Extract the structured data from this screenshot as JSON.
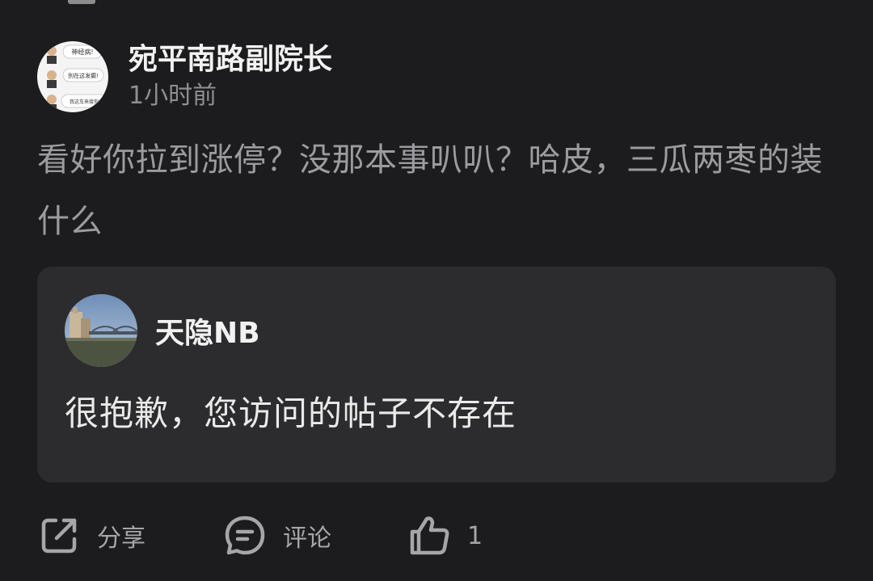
{
  "post": {
    "author": {
      "name": "宛平南路副院长",
      "avatar_icon": "meme-avatar",
      "avatar_texts": [
        "神经病!",
        "别在这发癫!",
        "我这车来接你"
      ]
    },
    "time_ago": "1小时前",
    "content": "看好你拉到涨停？没那本事叭叭？哈皮，三瓜两枣的装什么"
  },
  "quoted_post": {
    "author": {
      "name": "天隐NB",
      "avatar_icon": "bridge-photo-avatar"
    },
    "message": "很抱歉，您访问的帖子不存在"
  },
  "actions": {
    "share": {
      "label": "分享",
      "icon": "share-icon"
    },
    "comment": {
      "label": "评论",
      "icon": "comment-icon"
    },
    "like": {
      "count": "1",
      "icon": "thumbs-up-icon"
    }
  },
  "colors": {
    "background": "#1c1c1e",
    "card": "#2c2c2e",
    "primary_text": "#f2f2f2",
    "secondary_text": "#9b9ba0",
    "icon": "#a5a5aa"
  }
}
